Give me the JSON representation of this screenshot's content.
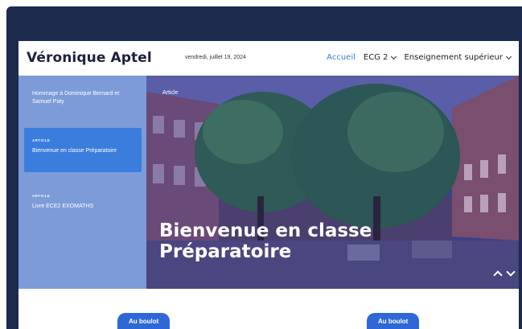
{
  "header": {
    "site_title": "Véronique Aptel",
    "date": "vendredi, juillet 19, 2024"
  },
  "nav": {
    "items": [
      {
        "label": "Accueil",
        "active": true,
        "has_dropdown": false
      },
      {
        "label": "ECG 2",
        "active": false,
        "has_dropdown": true
      },
      {
        "label": "Enseignement supérieur",
        "active": false,
        "has_dropdown": true
      }
    ]
  },
  "sidebar": {
    "entries": [
      {
        "kicker": "",
        "title": "Hommage à Dominique Bernard et Samuel Paty",
        "selected": false
      },
      {
        "kicker": "ARTICLE",
        "title": "Bienvenue en classe Préparatoire",
        "selected": true
      },
      {
        "kicker": "ARTICLE",
        "title": "Livre ECE2 EXOMATHS",
        "selected": false
      }
    ]
  },
  "hero": {
    "tag": "Article",
    "title": "Bienvenue en classe Préparatoire"
  },
  "buttons": {
    "left_label": "Au boulot",
    "right_label": "Au boulot"
  },
  "colors": {
    "accent": "#3b7ddd",
    "dark_bg": "#1c2a4e",
    "sidebar_bg": "#7d9bd8",
    "button_bg": "#2f67d6"
  }
}
